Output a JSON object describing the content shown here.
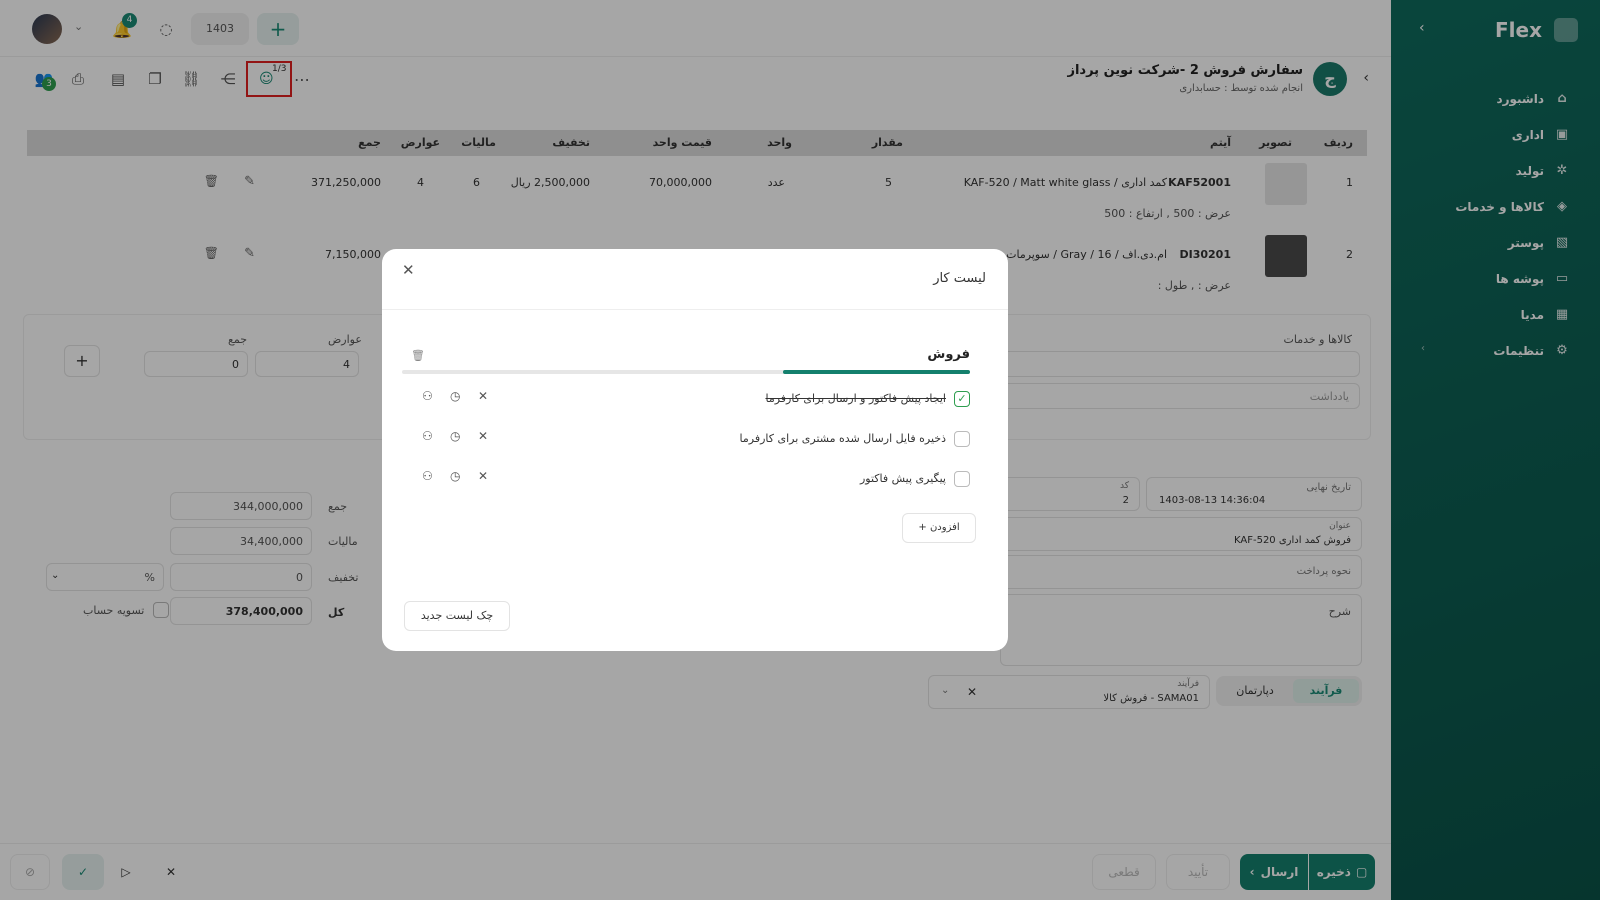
{
  "sidebar": {
    "brand": "Flex",
    "items": [
      {
        "label": "داشبورد",
        "icon": "home-icon"
      },
      {
        "label": "اداری",
        "icon": "briefcase-icon"
      },
      {
        "label": "تولید",
        "icon": "factory-icon"
      },
      {
        "label": "کالاها و خدمات",
        "icon": "box-icon"
      },
      {
        "label": "پوستر",
        "icon": "poster-icon"
      },
      {
        "label": "پوشه ها",
        "icon": "folder-icon"
      },
      {
        "label": "مدیا",
        "icon": "media-icon"
      },
      {
        "label": "تنظیمات",
        "icon": "gear-icon"
      }
    ]
  },
  "topbar": {
    "year": "1403",
    "notifications_count": "4"
  },
  "toolbar": {
    "checklist_badge": "1/3",
    "users_badge": "3"
  },
  "header": {
    "avatar_letter": "ج",
    "title": "سفارش فروش 2 -شرکت نوین پرداز",
    "subtitle": "انجام شده توسط : حسابداری"
  },
  "table": {
    "headers": [
      "ردیف",
      "تصویر",
      "آیتم",
      "مقدار",
      "واحد",
      "قیمت واحد",
      "تخفیف",
      "مالیات",
      "عوارض",
      "جمع"
    ],
    "rows": [
      {
        "index": "1",
        "code": "KAF52001",
        "name": "کمد اداری / KAF-520 / Matt white glass",
        "details": "عرض : 500 ,  ارتفاع : 500",
        "qty": "5",
        "unit": "عدد",
        "unit_price": "70,000,000",
        "discount": "2,500,000 ریال",
        "tax": "6",
        "duties": "4",
        "total": "371,250,000"
      },
      {
        "index": "2",
        "code": "DI30201",
        "name": "ام.دی.اف / 16 / Gray / سوپرمات",
        "details": "عرض : ,  طول :",
        "qty": "",
        "unit": "",
        "unit_price": "",
        "discount": "",
        "tax": "",
        "duties": "",
        "total": "7,150,000"
      }
    ]
  },
  "add_row": {
    "section_label": "کالاها و خدمات",
    "duties_label": "عوارض",
    "total_label": "جمع",
    "duties_value": "4",
    "total_value": "0",
    "note_placeholder": "یادداشت"
  },
  "summary": {
    "sum_label": "جمع",
    "sum_value": "344,000,000",
    "tax_label": "مالیات",
    "tax_value": "34,400,000",
    "discount_label": "تخفیف",
    "discount_value": "0",
    "discount_unit": "%",
    "total_label": "کل",
    "total_value": "378,400,000",
    "settle_label": "تسویه حساب"
  },
  "form": {
    "final_date_label": "تاریخ نهایی",
    "final_date_value": "1403-08-13 14:36:04",
    "code_label": "کد",
    "code_value": "2",
    "title_label": "عنوان",
    "title_value": "فروش کمد اداری KAF-520",
    "payment_label": "نحوه پرداخت",
    "description_label": "شرح",
    "process_tab": "فرآیند",
    "department_tab": "دپارتمان",
    "process_label": "فرآیند",
    "process_value": "SAMA01 - فروش کالا"
  },
  "bottom": {
    "save": "ذخیره",
    "send": "ارسال",
    "confirm": "تأیید",
    "final": "قطعی"
  },
  "modal": {
    "title": "لیست کار",
    "checklist_name": "فروش",
    "progress": 0.33,
    "items": [
      {
        "label": "ایجاد پیش فاکتور و ارسال برای کارفرما",
        "done": true
      },
      {
        "label": "ذخیره فایل ارسال شده مشتری برای کارفرما",
        "done": false
      },
      {
        "label": "پیگیری پیش فاکتور",
        "done": false
      }
    ],
    "add_label": "افزودن",
    "new_checklist_label": "چک لیست جدید"
  }
}
